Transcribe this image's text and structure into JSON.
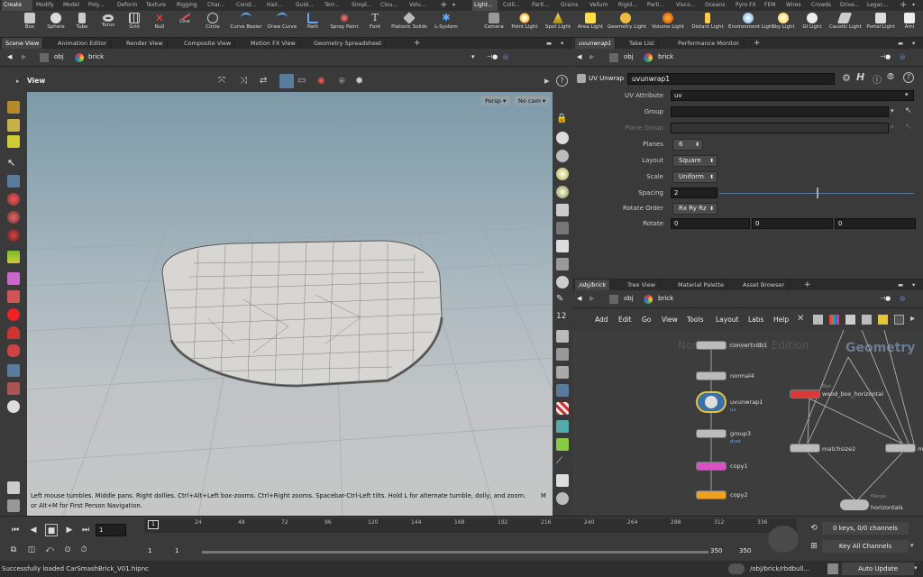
{
  "shelf_tabs_left": [
    "Create",
    "Modify",
    "Model",
    "Poly...",
    "Deform",
    "Texture",
    "Rigging",
    "Char...",
    "Const...",
    "Hair...",
    "Guid...",
    "Terr...",
    "Simpl...",
    "Clou...",
    "Volu..."
  ],
  "shelf_tabs_right": [
    "Light...",
    "Colli...",
    "Parti...",
    "Grains",
    "Vellum",
    "Rigid...",
    "Parti...",
    "Visco...",
    "Oceans",
    "Pyro FX",
    "FEM",
    "Wires",
    "Crowds",
    "Drive...",
    "Legac..."
  ],
  "shelf_tools_left": [
    "Box",
    "Sphere",
    "Tube",
    "Torus",
    "Grid",
    "Null",
    "Line",
    "Circle",
    "Curve Bezier",
    "Draw Curve",
    "Path",
    "Spray Paint",
    "Font",
    "Platonic Solids",
    "L-System"
  ],
  "shelf_tools_right": [
    "Camera",
    "Point Light",
    "Spot Light",
    "Area Light",
    "Geometry Light",
    "Volume Light",
    "Distant Light",
    "Environment Light",
    "Sky Light",
    "GI Light",
    "Caustic Light",
    "Portal Light",
    "Ami"
  ],
  "left_pane_tabs": [
    "Scene View",
    "Animation Editor",
    "Render View",
    "Composite View",
    "Motion FX View",
    "Geometry Spreadsheet"
  ],
  "right_pane_tabs": [
    "uvunwrap1",
    "Take List",
    "Performance Monitor"
  ],
  "path": {
    "obj": "obj",
    "node": "brick"
  },
  "viewport": {
    "label": "View",
    "persp": "Persp",
    "cam": "No cam",
    "help_line1": "Left mouse tumbles. Middle pans. Right dollies. Ctrl+Alt+Left box-zooms. Ctrl+Right zooms. Spacebar-Ctrl-Left tilts. Hold L for alternate tumble, dolly, and zoom.",
    "help_m": "M",
    "help_line2": "or Alt+M for First Person Navigation."
  },
  "params": {
    "node_type": "UV Unwrap",
    "node_name": "uvunwrap1",
    "uv_attribute_label": "UV Attribute",
    "uv_attribute_value": "uv",
    "group_label": "Group",
    "group_value": "",
    "plane_group_label": "Plane Group",
    "planes_label": "Planes",
    "planes_value": "6",
    "layout_label": "Layout",
    "layout_value": "Square",
    "scale_label": "Scale",
    "scale_value": "Uniform",
    "spacing_label": "Spacing",
    "spacing_value": "2",
    "spacing_fraction": 0.5,
    "rotate_order_label": "Rotate Order",
    "rotate_order_value": "Rx Ry Rz",
    "rotate_label": "Rotate",
    "rotate_x": "0",
    "rotate_y": "0",
    "rotate_z": "0"
  },
  "net_tabs": [
    "/obj/brick",
    "Tree View",
    "Material Palette",
    "Asset Browser"
  ],
  "net_menu": [
    "Add",
    "Edit",
    "Go",
    "View",
    "Tools",
    "Layout",
    "Labs",
    "Help"
  ],
  "net_watermark_left": "Non-Commercial Edition",
  "net_watermark_right": "Geometry",
  "nodes": {
    "convertvdb": "convertvdb1",
    "normal": "normal4",
    "uvunwrap": "uvunwrap1",
    "uvunwrap_sub": "uv",
    "group": "group3",
    "group_sub": "dust",
    "copy1": "copy1",
    "copy2": "copy2",
    "box_tag": "Box",
    "box": "wood_box_horizontal",
    "matchsize": "matchsize2",
    "matchsize_sub": "m",
    "merge_tag": "Merge",
    "merge": "horizontals"
  },
  "timeline": {
    "ticks": [
      "1",
      "24",
      "48",
      "72",
      "96",
      "120",
      "144",
      "168",
      "192",
      "216",
      "240",
      "264",
      "288",
      "312",
      "336"
    ],
    "current_frame": "1",
    "range_start": "1",
    "range_start2": "1",
    "range_end": "350",
    "range_end2": "350",
    "keys_info": "0 keys, 0/0 channels",
    "key_channels": "Key All Channels"
  },
  "status": {
    "message": "Successfully loaded CarSmashBrick_V01.hipnc",
    "path": "/obj/brick/rbdbull...",
    "update_mode": "Auto Update"
  },
  "colors": {
    "accent": "#3b6fa8",
    "copy1": "#d94fc4",
    "copy2": "#f0a020",
    "box": "#d83a3a"
  }
}
